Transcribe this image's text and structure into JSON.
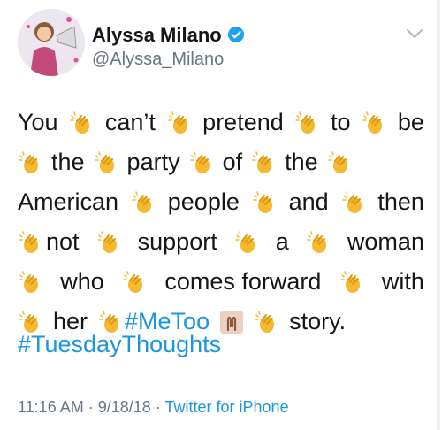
{
  "author": {
    "name": "Alyssa Milano",
    "handle": "@Alyssa_Milano",
    "verified": true
  },
  "tweet": {
    "lines": [
      [
        "You",
        "can’t",
        "pretend",
        "to",
        "be"
      ],
      [
        "the",
        "party",
        "of",
        "the"
      ],
      [
        "American",
        "people",
        "and",
        "then"
      ],
      [
        "not",
        "support",
        "a",
        "woman"
      ],
      [
        "who",
        "comes forward",
        "with"
      ],
      [
        "her",
        "#MeToo",
        "story."
      ]
    ],
    "hashtag_metoo": "#MeToo",
    "hashtag_tuesday": "#TuesdayThoughts"
  },
  "meta": {
    "time": "11:16 AM",
    "date": "9/18/18",
    "separator": "·",
    "source": "Twitter for iPhone"
  },
  "colors": {
    "link": "#1b95e0",
    "muted": "#657786",
    "text": "#14171a",
    "verified": "#1da1f2"
  },
  "icons": {
    "clap": "clapping-hands-emoji",
    "hands": "raised-hands-emoji",
    "verified": "verified-badge-icon",
    "caret": "chevron-down-icon"
  }
}
